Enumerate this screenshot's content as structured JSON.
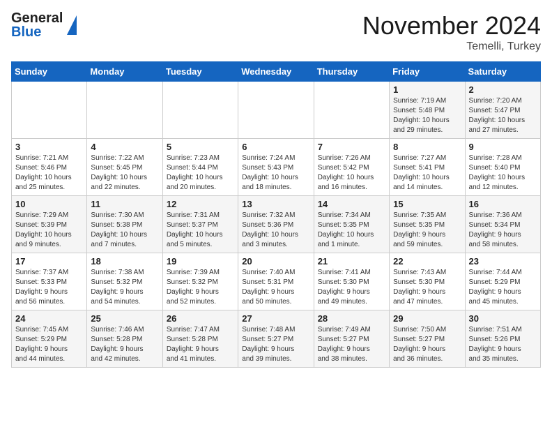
{
  "header": {
    "logo_general": "General",
    "logo_blue": "Blue",
    "month_title": "November 2024",
    "location": "Temelli, Turkey"
  },
  "days_of_week": [
    "Sunday",
    "Monday",
    "Tuesday",
    "Wednesday",
    "Thursday",
    "Friday",
    "Saturday"
  ],
  "weeks": [
    [
      {
        "day": "",
        "info": ""
      },
      {
        "day": "",
        "info": ""
      },
      {
        "day": "",
        "info": ""
      },
      {
        "day": "",
        "info": ""
      },
      {
        "day": "",
        "info": ""
      },
      {
        "day": "1",
        "info": "Sunrise: 7:19 AM\nSunset: 5:48 PM\nDaylight: 10 hours\nand 29 minutes."
      },
      {
        "day": "2",
        "info": "Sunrise: 7:20 AM\nSunset: 5:47 PM\nDaylight: 10 hours\nand 27 minutes."
      }
    ],
    [
      {
        "day": "3",
        "info": "Sunrise: 7:21 AM\nSunset: 5:46 PM\nDaylight: 10 hours\nand 25 minutes."
      },
      {
        "day": "4",
        "info": "Sunrise: 7:22 AM\nSunset: 5:45 PM\nDaylight: 10 hours\nand 22 minutes."
      },
      {
        "day": "5",
        "info": "Sunrise: 7:23 AM\nSunset: 5:44 PM\nDaylight: 10 hours\nand 20 minutes."
      },
      {
        "day": "6",
        "info": "Sunrise: 7:24 AM\nSunset: 5:43 PM\nDaylight: 10 hours\nand 18 minutes."
      },
      {
        "day": "7",
        "info": "Sunrise: 7:26 AM\nSunset: 5:42 PM\nDaylight: 10 hours\nand 16 minutes."
      },
      {
        "day": "8",
        "info": "Sunrise: 7:27 AM\nSunset: 5:41 PM\nDaylight: 10 hours\nand 14 minutes."
      },
      {
        "day": "9",
        "info": "Sunrise: 7:28 AM\nSunset: 5:40 PM\nDaylight: 10 hours\nand 12 minutes."
      }
    ],
    [
      {
        "day": "10",
        "info": "Sunrise: 7:29 AM\nSunset: 5:39 PM\nDaylight: 10 hours\nand 9 minutes."
      },
      {
        "day": "11",
        "info": "Sunrise: 7:30 AM\nSunset: 5:38 PM\nDaylight: 10 hours\nand 7 minutes."
      },
      {
        "day": "12",
        "info": "Sunrise: 7:31 AM\nSunset: 5:37 PM\nDaylight: 10 hours\nand 5 minutes."
      },
      {
        "day": "13",
        "info": "Sunrise: 7:32 AM\nSunset: 5:36 PM\nDaylight: 10 hours\nand 3 minutes."
      },
      {
        "day": "14",
        "info": "Sunrise: 7:34 AM\nSunset: 5:35 PM\nDaylight: 10 hours\nand 1 minute."
      },
      {
        "day": "15",
        "info": "Sunrise: 7:35 AM\nSunset: 5:35 PM\nDaylight: 9 hours\nand 59 minutes."
      },
      {
        "day": "16",
        "info": "Sunrise: 7:36 AM\nSunset: 5:34 PM\nDaylight: 9 hours\nand 58 minutes."
      }
    ],
    [
      {
        "day": "17",
        "info": "Sunrise: 7:37 AM\nSunset: 5:33 PM\nDaylight: 9 hours\nand 56 minutes."
      },
      {
        "day": "18",
        "info": "Sunrise: 7:38 AM\nSunset: 5:32 PM\nDaylight: 9 hours\nand 54 minutes."
      },
      {
        "day": "19",
        "info": "Sunrise: 7:39 AM\nSunset: 5:32 PM\nDaylight: 9 hours\nand 52 minutes."
      },
      {
        "day": "20",
        "info": "Sunrise: 7:40 AM\nSunset: 5:31 PM\nDaylight: 9 hours\nand 50 minutes."
      },
      {
        "day": "21",
        "info": "Sunrise: 7:41 AM\nSunset: 5:30 PM\nDaylight: 9 hours\nand 49 minutes."
      },
      {
        "day": "22",
        "info": "Sunrise: 7:43 AM\nSunset: 5:30 PM\nDaylight: 9 hours\nand 47 minutes."
      },
      {
        "day": "23",
        "info": "Sunrise: 7:44 AM\nSunset: 5:29 PM\nDaylight: 9 hours\nand 45 minutes."
      }
    ],
    [
      {
        "day": "24",
        "info": "Sunrise: 7:45 AM\nSunset: 5:29 PM\nDaylight: 9 hours\nand 44 minutes."
      },
      {
        "day": "25",
        "info": "Sunrise: 7:46 AM\nSunset: 5:28 PM\nDaylight: 9 hours\nand 42 minutes."
      },
      {
        "day": "26",
        "info": "Sunrise: 7:47 AM\nSunset: 5:28 PM\nDaylight: 9 hours\nand 41 minutes."
      },
      {
        "day": "27",
        "info": "Sunrise: 7:48 AM\nSunset: 5:27 PM\nDaylight: 9 hours\nand 39 minutes."
      },
      {
        "day": "28",
        "info": "Sunrise: 7:49 AM\nSunset: 5:27 PM\nDaylight: 9 hours\nand 38 minutes."
      },
      {
        "day": "29",
        "info": "Sunrise: 7:50 AM\nSunset: 5:27 PM\nDaylight: 9 hours\nand 36 minutes."
      },
      {
        "day": "30",
        "info": "Sunrise: 7:51 AM\nSunset: 5:26 PM\nDaylight: 9 hours\nand 35 minutes."
      }
    ]
  ]
}
